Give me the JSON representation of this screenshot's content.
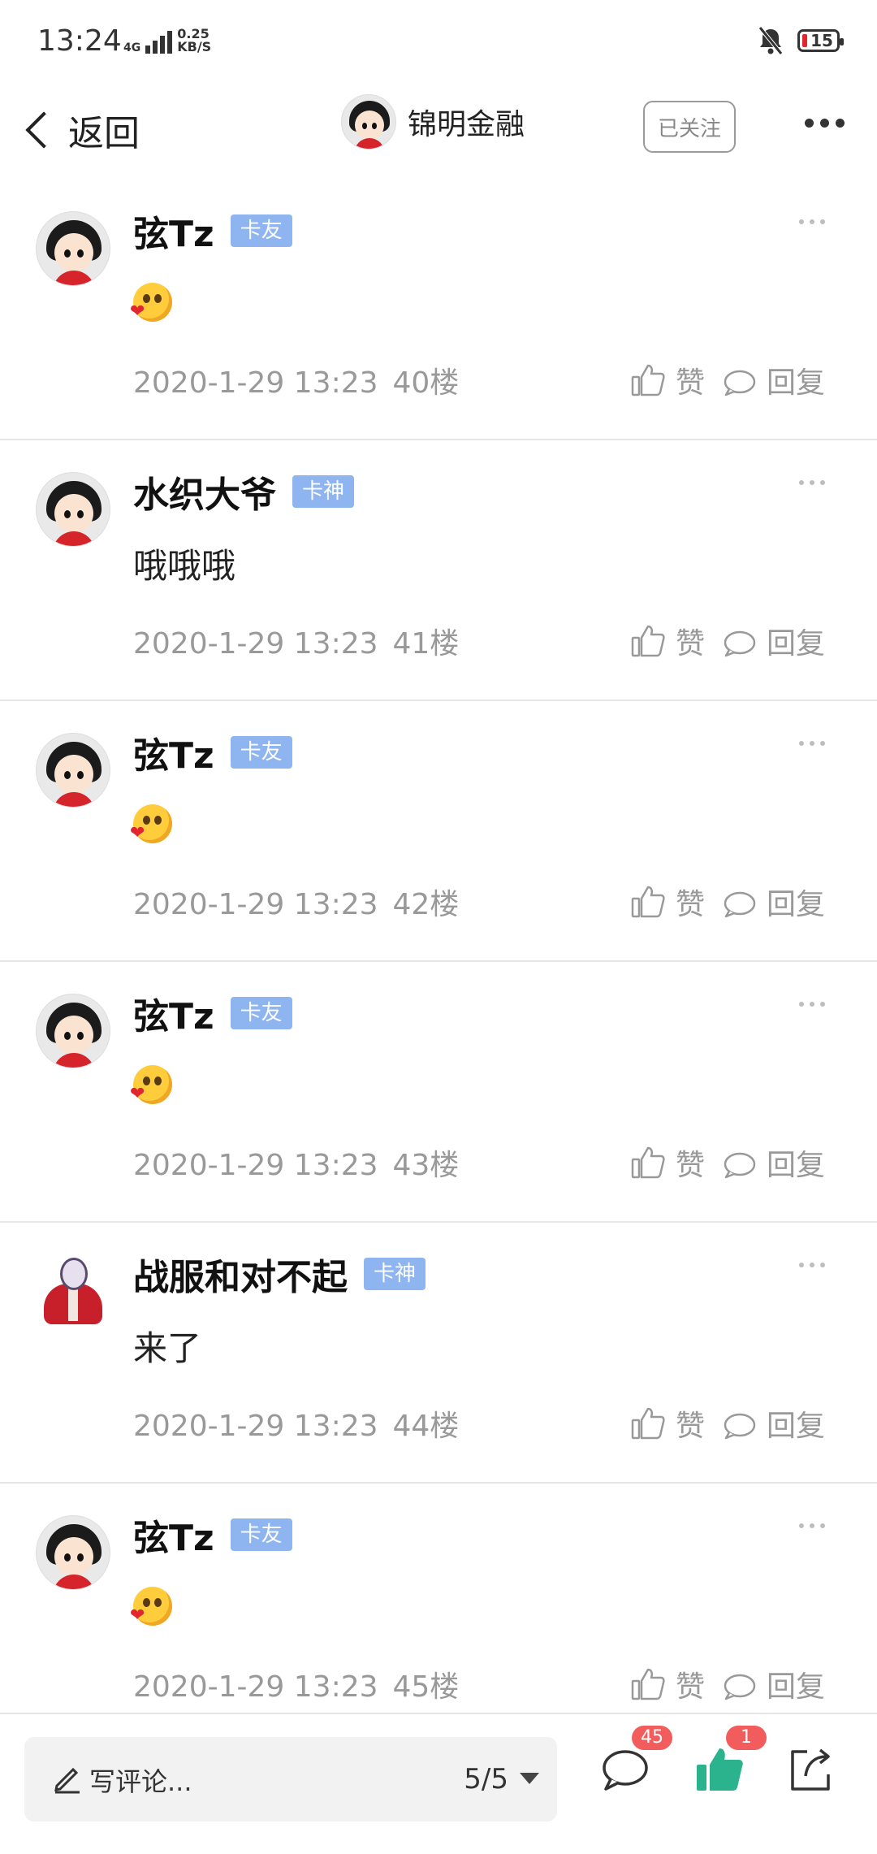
{
  "status_bar": {
    "time": "13:24",
    "network_type": "4G",
    "speed_value": "0.25",
    "speed_unit": "KB/S",
    "battery_level": "15",
    "icons": [
      "signal-icon",
      "mute-bell-icon",
      "battery-icon"
    ]
  },
  "header": {
    "back_label": "返回",
    "account_name": "锦明金融",
    "follow_label": "已关注",
    "icons": [
      "back-arrow-icon",
      "more-icon"
    ]
  },
  "posts": [
    {
      "name": "弦Tz",
      "badge": "卡友",
      "content": "",
      "emoji": "heart-emoji",
      "time": "2020-1-29 13:23",
      "floor": "40楼",
      "like": "赞",
      "reply": "回复"
    },
    {
      "name": "水织大爷",
      "badge": "卡神",
      "content": "哦哦哦",
      "emoji": "",
      "time": "2020-1-29 13:23",
      "floor": "41楼",
      "like": "赞",
      "reply": "回复"
    },
    {
      "name": "弦Tz",
      "badge": "卡友",
      "content": "",
      "emoji": "heart-emoji",
      "time": "2020-1-29 13:23",
      "floor": "42楼",
      "like": "赞",
      "reply": "回复"
    },
    {
      "name": "弦Tz",
      "badge": "卡友",
      "content": "",
      "emoji": "heart-emoji",
      "time": "2020-1-29 13:23",
      "floor": "43楼",
      "like": "赞",
      "reply": "回复"
    },
    {
      "name": "战服和对不起",
      "badge": "卡神",
      "content": "来了",
      "emoji": "",
      "time": "2020-1-29 13:23",
      "floor": "44楼",
      "like": "赞",
      "reply": "回复"
    },
    {
      "name": "弦Tz",
      "badge": "卡友",
      "content": "",
      "emoji": "heart-emoji",
      "time": "2020-1-29 13:23",
      "floor": "45楼",
      "like": "赞",
      "reply": "回复"
    }
  ],
  "bottom_bar": {
    "comment_placeholder": "写评论...",
    "page_indicator": "5/5",
    "comment_count": "45",
    "like_count": "1",
    "like_color": "#2ab38c",
    "badge_color": "#f25c5c",
    "icons": [
      "pen-icon",
      "comment-icon",
      "thumbs-up-icon",
      "share-icon"
    ]
  },
  "colors": {
    "badge_bg": "#8eb5f0",
    "meta_text": "#999999"
  }
}
